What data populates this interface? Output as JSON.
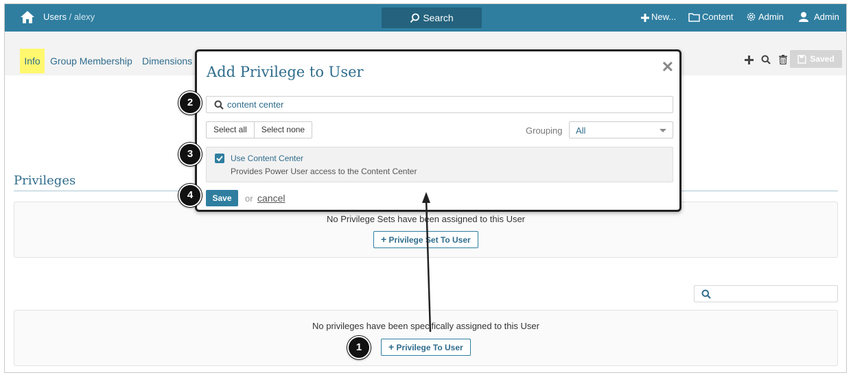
{
  "header": {
    "breadcrumb_section": "Users",
    "breadcrumb_separator": "/",
    "breadcrumb_user": "alexy",
    "search_label": "Search",
    "new_label": "New...",
    "content_label": "Content",
    "admin_label": "Admin",
    "user_label": "Admin"
  },
  "tabs": [
    {
      "label": "Info"
    },
    {
      "label": "Group Membership"
    },
    {
      "label": "Dimensions"
    }
  ],
  "toolbar": {
    "saved_label": "Saved"
  },
  "privileges": {
    "title": "Privileges",
    "sets_empty_msg": "No Privilege Sets have been assigned to this User",
    "sets_button": "Privilege Set To User",
    "direct_empty_msg": "No privileges have been specifically assigned to this User",
    "direct_button": "Privilege To User"
  },
  "modal": {
    "title": "Add Privilege to User",
    "search_value": "content center",
    "select_all": "Select all",
    "select_none": "Select none",
    "grouping_label": "Grouping",
    "grouping_value": "All",
    "item_name": "Use Content Center",
    "item_description": "Provides Power User access to the Content Center",
    "save_label": "Save",
    "or_text": "or",
    "cancel_label": "cancel"
  },
  "steps": [
    "1",
    "2",
    "3",
    "4"
  ],
  "colors": {
    "topbar": "#2f7ea0",
    "accent_text": "#2f6c8c",
    "tab_highlight": "#fff86e"
  }
}
